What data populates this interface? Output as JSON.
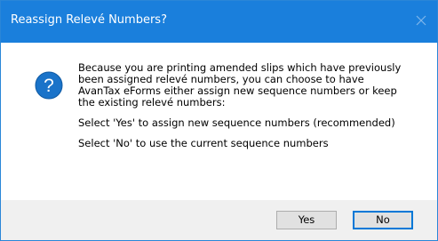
{
  "dialog": {
    "title": "Reassign Relevé Numbers?",
    "icon": "question-icon",
    "message_lines": [
      "Because you are printing amended slips which have previously",
      "been assigned relevé numbers, you can choose to have",
      "AvanTax eForms either assign new sequence numbers or keep",
      "the existing relevé numbers:"
    ],
    "yes_hint": "Select 'Yes' to assign new sequence numbers (recommended)",
    "no_hint": "Select 'No' to use the current sequence numbers",
    "yes_label": "Yes",
    "no_label": "No"
  },
  "colors": {
    "titlebar": "#1a7fdc",
    "icon_blue": "#1a73c9",
    "footer": "#f0f0f0",
    "default_button_border": "#0078d7"
  }
}
